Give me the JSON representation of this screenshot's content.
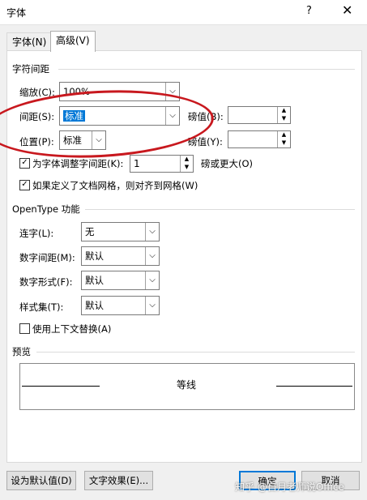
{
  "window": {
    "title": "字体",
    "help": "?",
    "close": "✕"
  },
  "tabs": [
    {
      "label": "字体(N)"
    },
    {
      "label": "高级(V)"
    }
  ],
  "spacing": {
    "section_title": "字符间距",
    "scale": {
      "label": "缩放(C):",
      "value": "100%"
    },
    "spacing": {
      "label": "间距(S):",
      "value": "标准"
    },
    "position": {
      "label": "位置(P):",
      "value": "标准"
    },
    "measure1": {
      "label": "磅值(B):",
      "value": ""
    },
    "measure2": {
      "label": "磅值(Y):",
      "value": ""
    },
    "kerning": {
      "label": "为字体调整字间距(K):",
      "value": "1",
      "suffix": "磅或更大(O)",
      "checked": true
    },
    "grid": {
      "label": "如果定义了文档网格，则对齐到网格(W)",
      "checked": true
    }
  },
  "opentype": {
    "section_title": "OpenType 功能",
    "ligatures": {
      "label": "连字(L):",
      "value": "无"
    },
    "num_spacing": {
      "label": "数字间距(M):",
      "value": "默认"
    },
    "num_forms": {
      "label": "数字形式(F):",
      "value": "默认"
    },
    "stylistic": {
      "label": "样式集(T):",
      "value": "默认"
    },
    "contextual": {
      "label": "使用上下文替换(A)",
      "checked": false
    }
  },
  "preview": {
    "section_title": "预览",
    "text": "等线"
  },
  "footer": {
    "default_button": "设为默认值(D)",
    "effects_button": "文字效果(E)...",
    "ok_button": "确定",
    "cancel_button": "取消"
  },
  "watermark": "知乎 @自月老师说Office",
  "annotation_color": "#c8181e"
}
